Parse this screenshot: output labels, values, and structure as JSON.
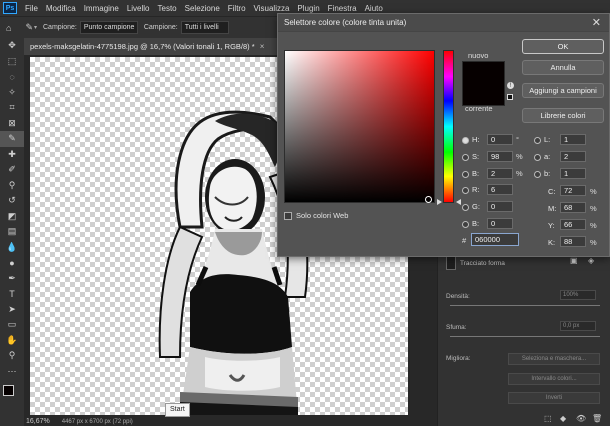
{
  "menubar": {
    "logo": "Ps",
    "items": [
      "File",
      "Modifica",
      "Immagine",
      "Livello",
      "Testo",
      "Selezione",
      "Filtro",
      "Visualizza",
      "Plugin",
      "Finestra",
      "Aiuto"
    ]
  },
  "options_bar": {
    "sample_label": "Campione:",
    "sample_value": "Punto campione",
    "layers_label": "Campione:",
    "layers_value": "Tutti i livelli"
  },
  "document": {
    "tab_title": "pexels-maksgelatin-4775198.jpg @ 16,7% (Valori tonali 1, RGB/8) *",
    "close_glyph": "×",
    "zoom": "16,67%",
    "info": "4467 px x 6700 px (72 ppi)"
  },
  "tooltip": "Start",
  "dialog": {
    "title": "Selettore colore (colore tinta unita)",
    "close_glyph": "✕",
    "new_label": "nuovo",
    "current_label": "corrente",
    "new_color": "#060000",
    "current_color": "#060000",
    "web_only_label": "Solo colori Web",
    "buttons": {
      "ok": "OK",
      "cancel": "Annulla",
      "add_swatches": "Aggiungi a campioni",
      "libraries": "Librerie colori"
    },
    "hsb": {
      "h_label": "H:",
      "h_value": "0",
      "h_unit": "°",
      "s_label": "S:",
      "s_value": "98",
      "s_unit": "%",
      "b_label": "B:",
      "b_value": "2",
      "b_unit": "%"
    },
    "rgb": {
      "r_label": "R:",
      "r_value": "6",
      "g_label": "G:",
      "g_value": "0",
      "b_label": "B:",
      "b_value": "0"
    },
    "lab": {
      "l_label": "L:",
      "l_value": "1",
      "a_label": "a:",
      "a_value": "2",
      "b_label": "b:",
      "b_value": "1"
    },
    "cmyk": {
      "c_label": "C:",
      "c_value": "72",
      "c_unit": "%",
      "m_label": "M:",
      "m_value": "68",
      "m_unit": "%",
      "y_label": "Y:",
      "y_value": "66",
      "y_unit": "%",
      "k_label": "K:",
      "k_value": "88",
      "k_unit": "%"
    },
    "hex_hash": "#",
    "hex_value": "060000"
  },
  "right_panel": {
    "mask_label": "Tracciato forma",
    "density_label": "Densità:",
    "density_value": "100%",
    "feather_label": "Sfuma:",
    "feather_value": "0,0 px",
    "refine_label": "Migliora:",
    "select_mask_btn": "Seleziona e maschera...",
    "color_range_btn": "Intervallo colori...",
    "invert_btn": "Inverti"
  }
}
